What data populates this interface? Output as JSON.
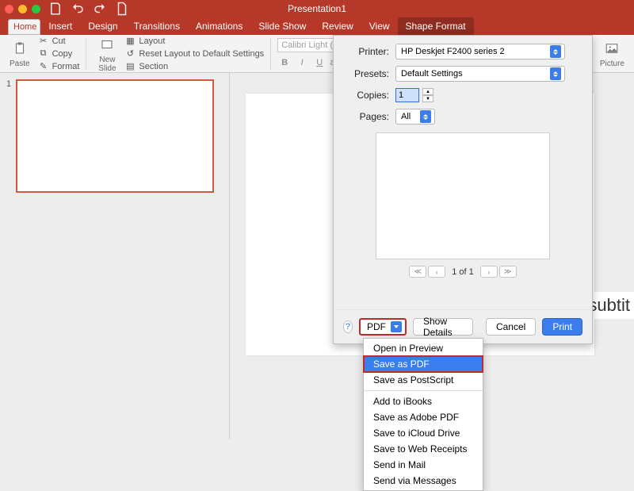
{
  "window": {
    "title": "Presentation1"
  },
  "tabs": {
    "home": "Home",
    "insert": "Insert",
    "design": "Design",
    "transitions": "Transitions",
    "animations": "Animations",
    "slideshow": "Slide Show",
    "review": "Review",
    "view": "View",
    "shapeformat": "Shape Format"
  },
  "ribbon": {
    "paste": "Paste",
    "cut": "Cut",
    "copy": "Copy",
    "format": "Format",
    "newslide": "New\nSlide",
    "layout": "Layout",
    "reset": "Reset Layout to Default Settings",
    "section": "Section",
    "font_name": "Calibri Light (Headi",
    "font_size": "",
    "picture": "Picture"
  },
  "thumbs": {
    "n1": "1"
  },
  "dialog": {
    "printer_label": "Printer:",
    "printer_value": "HP Deskjet F2400 series 2",
    "presets_label": "Presets:",
    "presets_value": "Default Settings",
    "copies_label": "Copies:",
    "copies_value": "1",
    "pages_label": "Pages:",
    "pages_value": "All",
    "pager": "1 of 1",
    "pdf": "PDF",
    "showdetails": "Show Details",
    "cancel": "Cancel",
    "print": "Print",
    "help": "?"
  },
  "menu": {
    "open_preview": "Open in Preview",
    "save_pdf": "Save as PDF",
    "save_ps": "Save as PostScript",
    "ibooks": "Add to iBooks",
    "adobe": "Save as Adobe PDF",
    "icloud": "Save to iCloud Drive",
    "webreceipts": "Save to Web Receipts",
    "mail": "Send in Mail",
    "messages": "Send via Messages"
  },
  "canvas": {
    "subtitle": "subtit"
  }
}
